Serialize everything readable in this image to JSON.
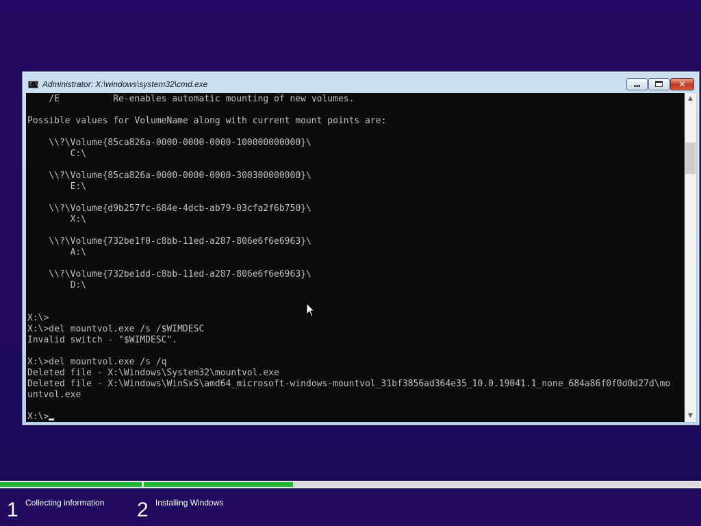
{
  "window": {
    "title": "Administrator: X:\\windows\\system32\\cmd.exe",
    "icon_label": "C:\\",
    "buttons": {
      "minimize": "minimize-icon",
      "maximize": "maximize-icon",
      "close": "close-icon"
    }
  },
  "console": {
    "lines": [
      "    /E          Re-enables automatic mounting of new volumes.",
      "",
      "Possible values for VolumeName along with current mount points are:",
      "",
      "    \\\\?\\Volume{85ca826a-0000-0000-0000-100000000000}\\",
      "        C:\\",
      "",
      "    \\\\?\\Volume{85ca826a-0000-0000-0000-300300000000}\\",
      "        E:\\",
      "",
      "    \\\\?\\Volume{d9b257fc-684e-4dcb-ab79-03cfa2f6b750}\\",
      "        X:\\",
      "",
      "    \\\\?\\Volume{732be1f0-c8bb-11ed-a287-806e6f6e6963}\\",
      "        A:\\",
      "",
      "    \\\\?\\Volume{732be1dd-c8bb-11ed-a287-806e6f6e6963}\\",
      "        D:\\",
      "",
      "",
      "X:\\>",
      "X:\\>del mountvol.exe /s /$WIMDESC",
      "Invalid switch - \"$WIMDESC\".",
      "",
      "X:\\>del mountvol.exe /s /q",
      "Deleted file - X:\\Windows\\System32\\mountvol.exe",
      "Deleted file - X:\\Windows\\WinSxS\\amd64_microsoft-windows-mountvol_31bf3856ad364e35_10.0.19041.1_none_684a86f0f0d0d27d\\mo",
      "untvol.exe",
      ""
    ],
    "prompt": "X:\\>"
  },
  "scrollbar": {
    "up_icon": "scroll-up-arrow-icon",
    "down_icon": "scroll-down-arrow-icon"
  },
  "setup": {
    "progress": [
      {
        "fill": 1.0
      },
      {
        "fill": 0.268
      }
    ],
    "steps": [
      {
        "number": "1",
        "label": "Collecting information"
      },
      {
        "number": "2",
        "label": "Installing Windows"
      }
    ]
  }
}
